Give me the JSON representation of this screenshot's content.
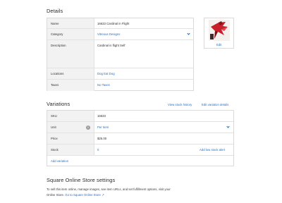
{
  "details": {
    "heading": "Details",
    "name_label": "Name",
    "name_value": "16633 Cardinal in Flight",
    "category_label": "Category",
    "category_value": "Vitreous Designs",
    "description_label": "Description",
    "description_value": "Cardinal in flight Sell'",
    "locations_label": "Locations",
    "locations_value": "Dog Eat Dog",
    "taxes_label": "Taxes",
    "taxes_value": "No Taxes",
    "image_edit_label": "Edit"
  },
  "variations": {
    "heading": "Variations",
    "stock_history_link": "View stock history",
    "edit_variation_link": "Edit variation details",
    "sku_label": "SKU",
    "sku_value": "16633",
    "unit_label": "Unit",
    "unit_value": "Per Item",
    "price_label": "Price",
    "price_value": "$25.00",
    "stock_label": "Stock",
    "stock_value": "0",
    "low_stock_link": "Add low stock alert",
    "add_variation_link": "Add variation"
  },
  "online_store": {
    "heading": "Square Online Store settings",
    "body_line1": "To sell this item online, manage images, see item URLs, and set fulfillment options, visit your",
    "body_line2_prefix": "Online Store.",
    "body_link": "Go to Square Online Store ↗"
  },
  "colors": {
    "accent": "#1c70cf",
    "label_bg": "#f2f2f2",
    "border": "#d9d9d9",
    "image_red": "#c8202a"
  },
  "icons": [
    "chevron-down-icon",
    "info-icon",
    "cardinal-image"
  ]
}
